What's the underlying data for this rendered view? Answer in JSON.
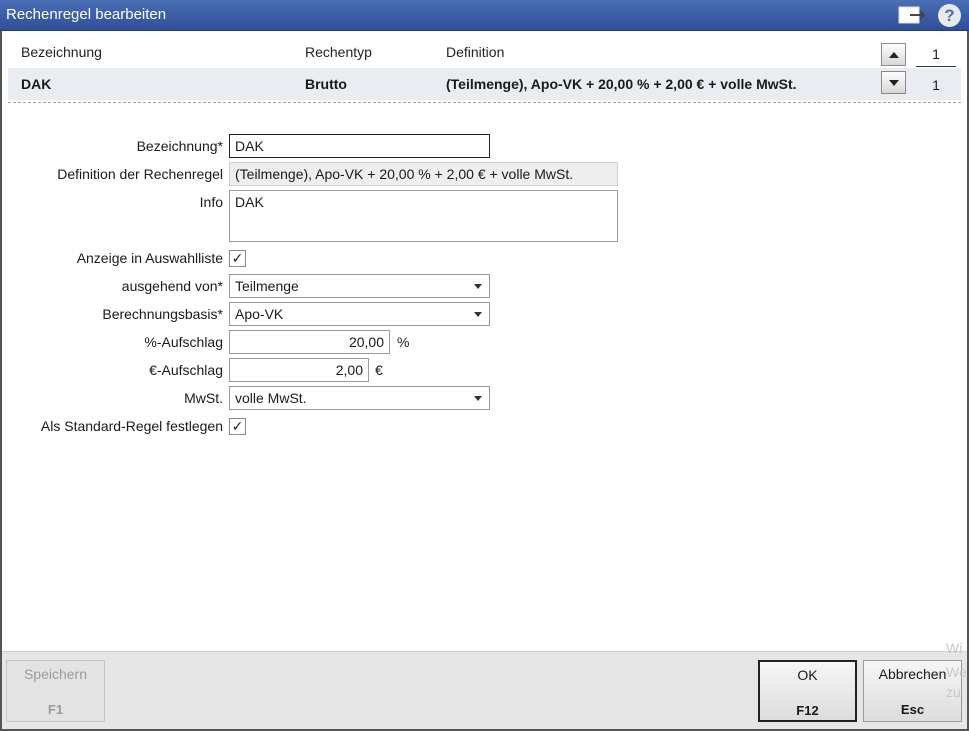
{
  "window": {
    "title": "Rechenregel bearbeiten",
    "help_label": "?"
  },
  "list": {
    "columns": [
      "Bezeichnung",
      "Rechentyp",
      "Definition"
    ],
    "selected_row": {
      "bezeichnung": "DAK",
      "rechentyp": "Brutto",
      "definition": "(Teilmenge), Apo-VK + 20,00 % + 2,00 € + volle MwSt."
    },
    "page_top": "1",
    "page_bottom": "1"
  },
  "form": {
    "bezeichnung": {
      "label": "Bezeichnung*",
      "value": "DAK"
    },
    "definition": {
      "label": "Definition der Rechenregel",
      "value": "(Teilmenge), Apo-VK + 20,00 % + 2,00 € + volle MwSt."
    },
    "info": {
      "label": "Info",
      "value": "DAK"
    },
    "anzeige": {
      "label": "Anzeige in Auswahlliste",
      "checked": true,
      "mark": "✓"
    },
    "ausgehend": {
      "label": "ausgehend von*",
      "value": "Teilmenge"
    },
    "basis": {
      "label": "Berechnungsbasis*",
      "value": "Apo-VK"
    },
    "prozent": {
      "label": "%-Aufschlag",
      "value": "20,00",
      "unit": "%"
    },
    "euro": {
      "label": "€-Aufschlag",
      "value": "2,00",
      "unit": "€"
    },
    "mwst": {
      "label": "MwSt.",
      "value": "volle MwSt."
    },
    "standard": {
      "label": "Als Standard-Regel festlegen",
      "checked": true,
      "mark": "✓"
    }
  },
  "footer": {
    "save": {
      "label": "Speichern",
      "key": "F1"
    },
    "ok": {
      "label": "OK",
      "key": "F12"
    },
    "cancel": {
      "label": "Abbrechen",
      "key": "Esc"
    }
  },
  "watermark": {
    "line1": "Wi",
    "line2": "We",
    "line3": "zu"
  },
  "icons": {
    "help": "help-icon",
    "export": "export-icon",
    "up": "arrow-up-icon",
    "down": "arrow-down-icon",
    "dropdown": "chevron-down-icon"
  }
}
